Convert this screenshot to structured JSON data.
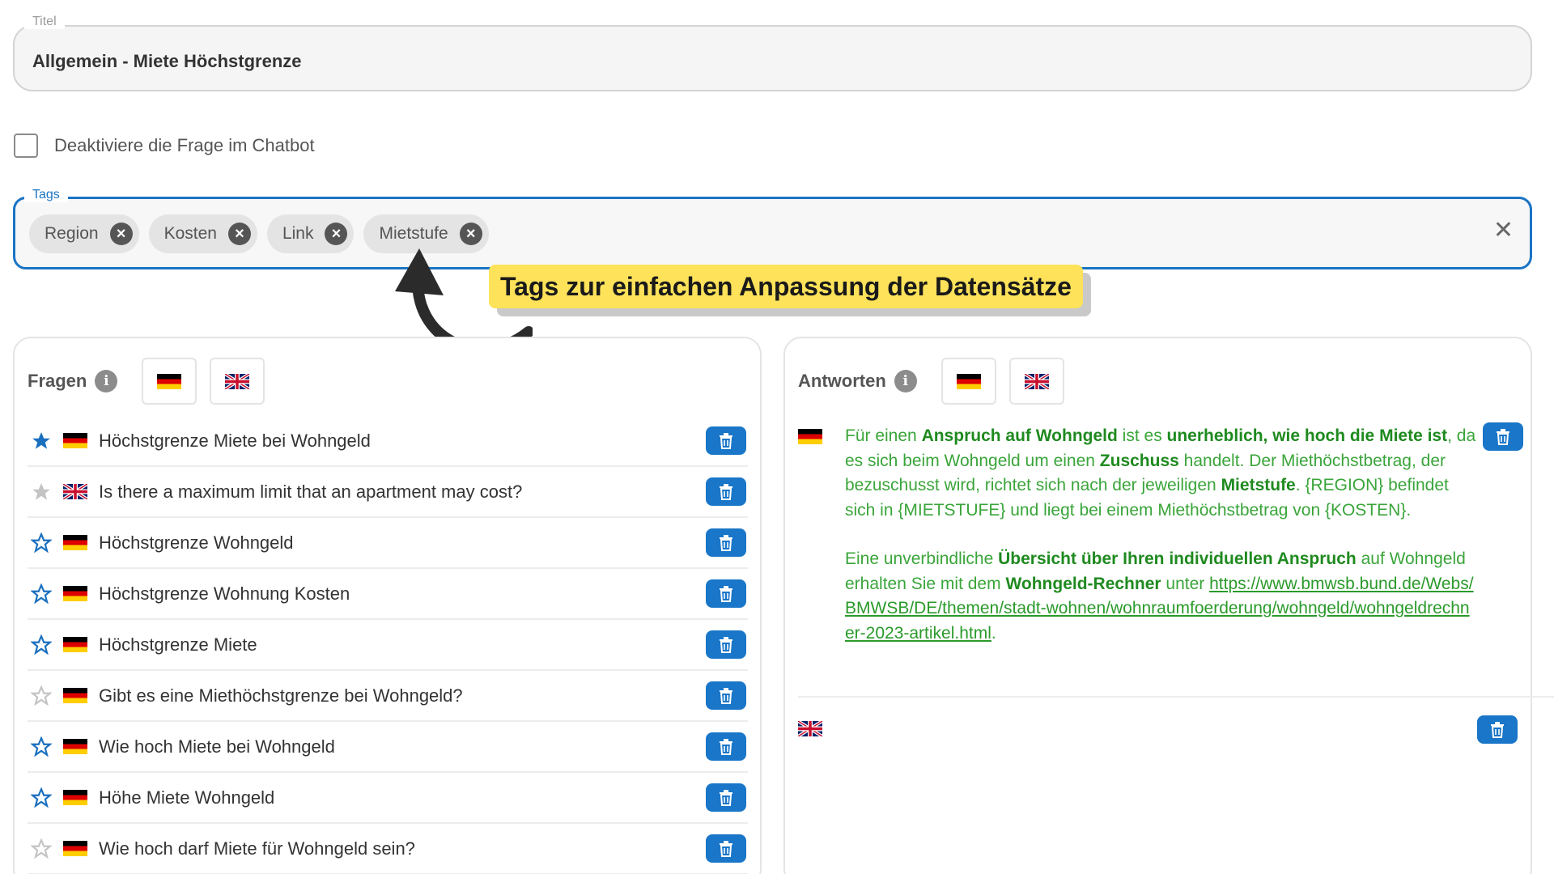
{
  "title_field": {
    "legend": "Titel",
    "value": "Allgemein - Miete Höchstgrenze"
  },
  "deactivate": {
    "label": "Deaktiviere die Frage im Chatbot",
    "checked": false
  },
  "tags": {
    "legend": "Tags",
    "chips": [
      "Region",
      "Kosten",
      "Link",
      "Mietstufe"
    ],
    "clear_icon": "close-icon"
  },
  "annotation": {
    "text": "Tags zur einfachen Anpassung der Datensätze",
    "color": "#fde25a"
  },
  "questions_panel": {
    "title": "Fragen",
    "languages": [
      "de",
      "en"
    ],
    "items": [
      {
        "star": "filled-blue",
        "lang": "de",
        "text": "Höchstgrenze Miete bei Wohngeld"
      },
      {
        "star": "filled-grey",
        "lang": "en",
        "text": "Is there a maximum limit that an apartment may cost?"
      },
      {
        "star": "outline-blue",
        "lang": "de",
        "text": "Höchstgrenze Wohngeld"
      },
      {
        "star": "outline-blue",
        "lang": "de",
        "text": "Höchstgrenze Wohnung Kosten"
      },
      {
        "star": "outline-blue",
        "lang": "de",
        "text": "Höchstgrenze Miete"
      },
      {
        "star": "outline-grey",
        "lang": "de",
        "text": "Gibt es eine Miethöchstgrenze bei Wohngeld?"
      },
      {
        "star": "outline-blue",
        "lang": "de",
        "text": "Wie hoch Miete bei Wohngeld"
      },
      {
        "star": "outline-blue",
        "lang": "de",
        "text": "Höhe Miete Wohngeld"
      },
      {
        "star": "outline-grey",
        "lang": "de",
        "text": "Wie hoch darf Miete für Wohngeld sein?"
      }
    ]
  },
  "answers_panel": {
    "title": "Antworten",
    "languages": [
      "de",
      "en"
    ],
    "answer_de": {
      "p1_a": "Für einen ",
      "p1_b": "Anspruch auf Wohngeld",
      "p1_c": " ist es ",
      "p1_d": "unerheblich, wie hoch die Miete ist",
      "p1_e": ", da es sich beim Wohngeld um einen ",
      "p1_f": "Zuschuss",
      "p1_g": " handelt. Der Miethöchstbetrag, der bezuschusst wird, richtet sich nach der jeweiligen ",
      "p1_h": "Mietstufe",
      "p1_i": ". {REGION} befindet sich in {MIETSTUFE} und liegt bei einem Miethöchstbetrag von {KOSTEN}.",
      "p2_a": "Eine unverbindliche ",
      "p2_b": "Übersicht über Ihren individuellen Anspruch",
      "p2_c": " auf Wohngeld erhalten Sie mit dem ",
      "p2_d": "Wohngeld-Rechner",
      "p2_e": " unter ",
      "link": "https://www.bmwsb.bund.de/Webs/BMWSB/DE/themen/stadt-wohnen/wohnraumfoerderung/wohngeld/wohngeldrechner-2023-artikel.html",
      "p2_end": "."
    },
    "answer_en": ""
  },
  "colors": {
    "accent": "#1b74c4",
    "button": "#1976c8",
    "answer_text": "#3aa53a"
  }
}
